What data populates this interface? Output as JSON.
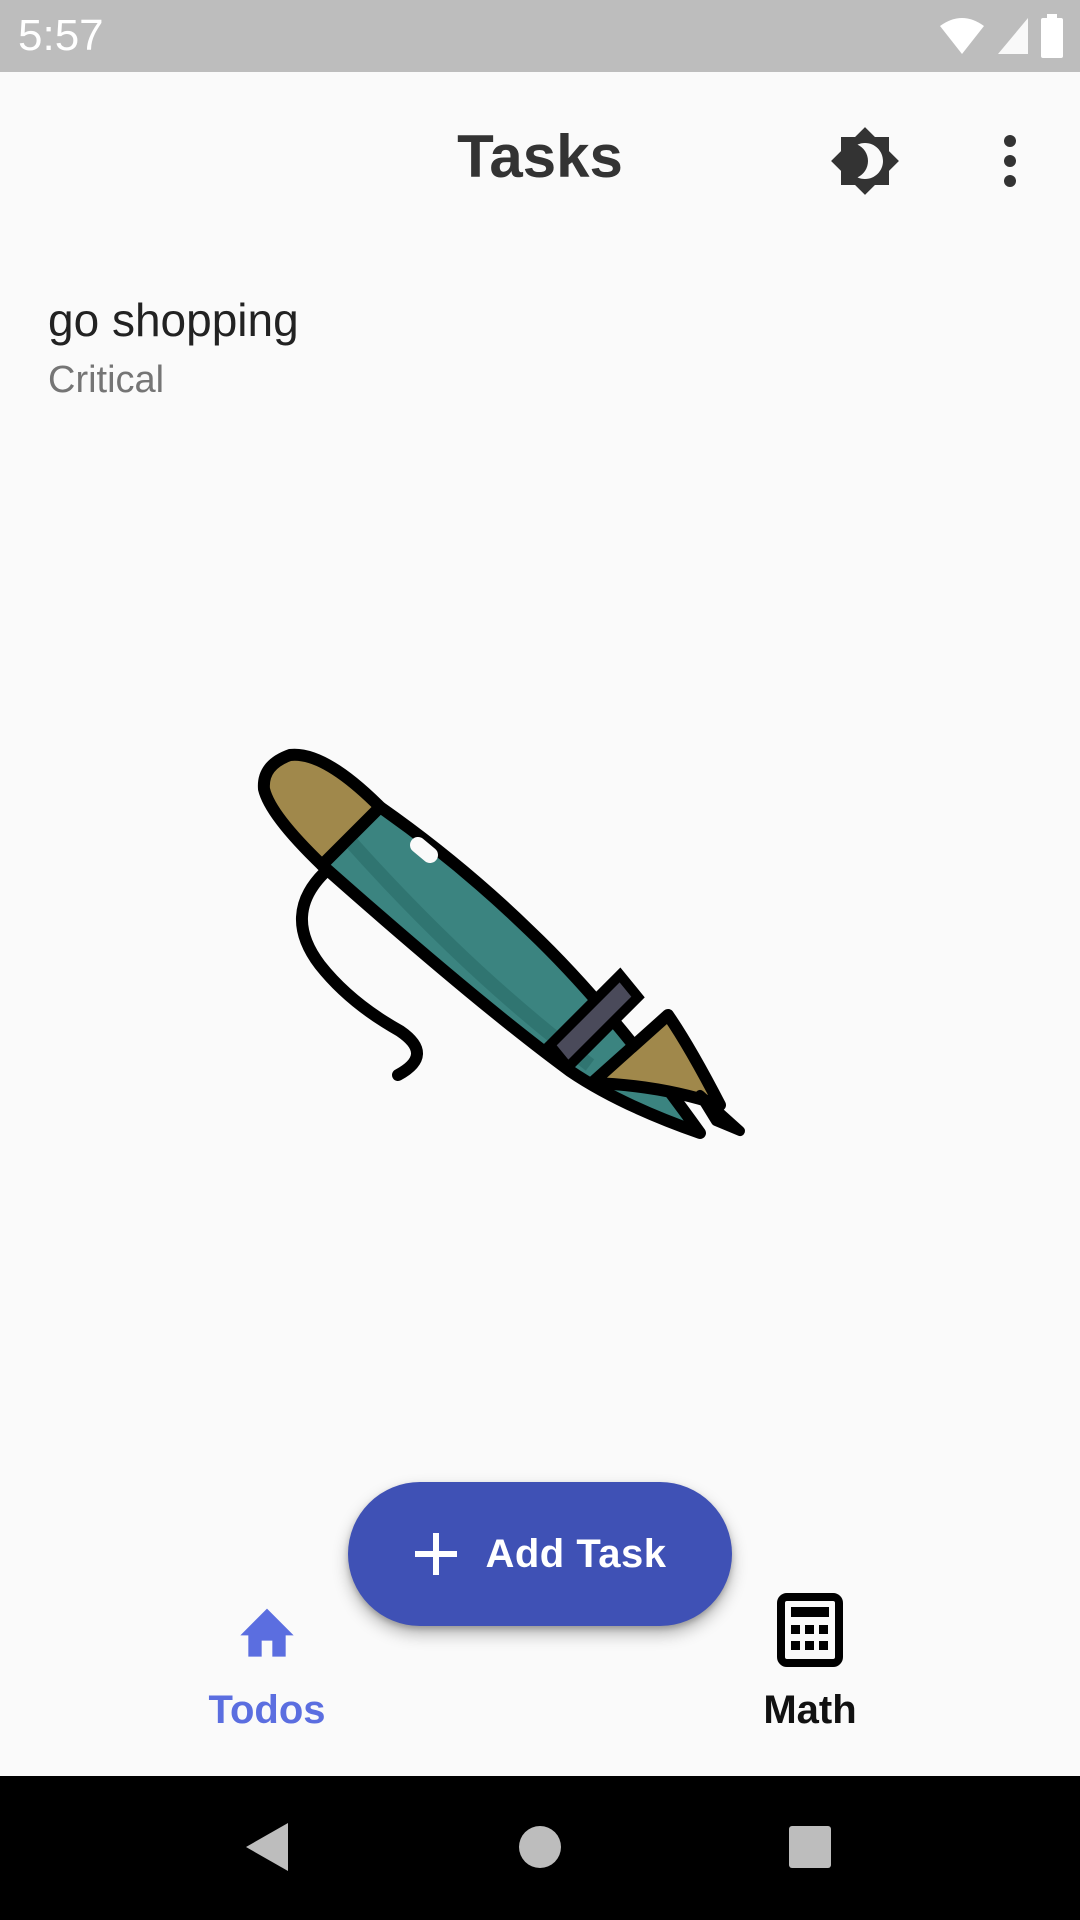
{
  "status_bar": {
    "time": "5:57",
    "icons": [
      "wifi-icon",
      "cell-signal-icon",
      "battery-icon"
    ]
  },
  "app_bar": {
    "title": "Tasks",
    "actions": [
      "brightness-icon",
      "more-vert-icon"
    ]
  },
  "tasks": [
    {
      "title": "go shopping",
      "priority": "Critical"
    }
  ],
  "illustration": {
    "icon": "pen-icon"
  },
  "fab": {
    "icon": "plus-icon",
    "label": "Add Task",
    "color": "#3f51b5"
  },
  "bottom_nav": {
    "items": [
      {
        "icon": "home-icon",
        "label": "Todos",
        "active": true,
        "color": "#5b6ee0"
      },
      {
        "icon": "calculator-icon",
        "label": "Math",
        "active": false,
        "color": "#111111"
      }
    ]
  },
  "system_nav": {
    "buttons": [
      "back-icon",
      "home-circle-icon",
      "recents-icon"
    ]
  }
}
